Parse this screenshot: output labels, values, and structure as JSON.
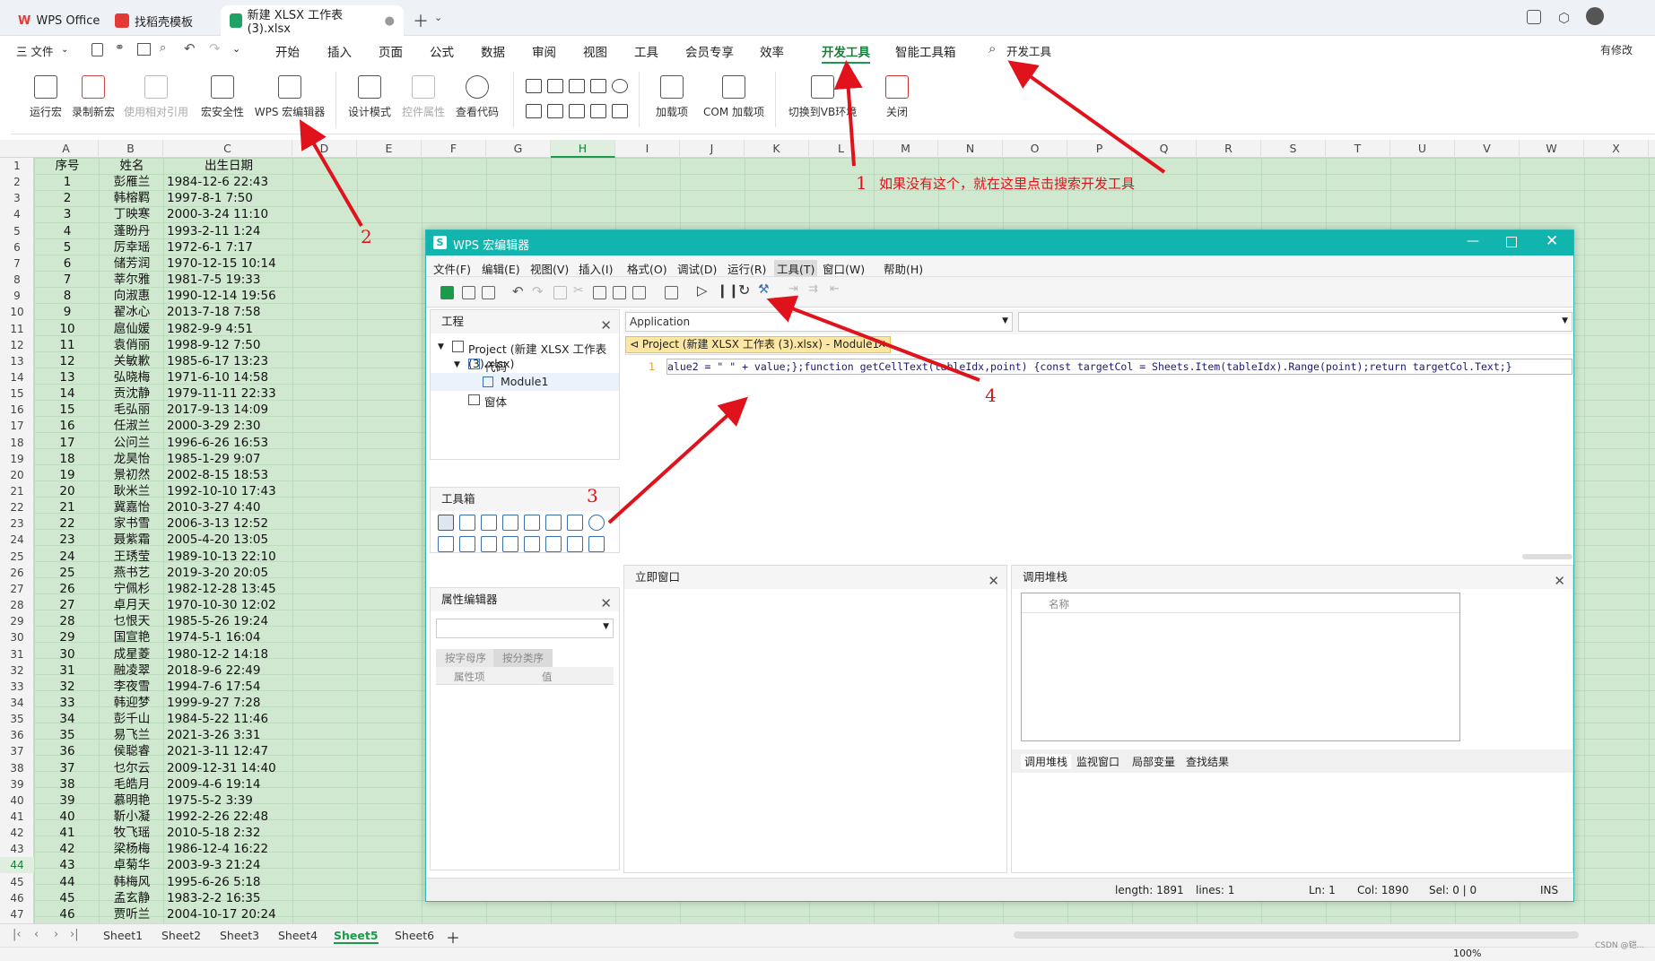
{
  "tabs": {
    "wps": "WPS Office",
    "template": "找稻壳模板",
    "doc": "新建 XLSX 工作表 (3).xlsx"
  },
  "menu": {
    "file": "三 文件",
    "items": [
      "开始",
      "插入",
      "页面",
      "公式",
      "数据",
      "审阅",
      "视图",
      "工具",
      "会员专享",
      "效率",
      "开发工具",
      "智能工具箱"
    ],
    "search": "开发工具",
    "edit_right": "有修改"
  },
  "ribbon": {
    "run_macro": "运行宏",
    "record_macro": "录制新宏",
    "relative_ref": "使用相对引用",
    "macro_security": "宏安全性",
    "wps_macro_editor": "WPS 宏编辑器",
    "design_mode": "设计模式",
    "control_props": "控件属性",
    "view_code": "查看代码",
    "addins": "加载项",
    "com_addins": "COM 加载项",
    "switch_vb": "切换到VB环境",
    "close": "关闭"
  },
  "columns": [
    "A",
    "B",
    "C",
    "D",
    "E",
    "F",
    "G",
    "H",
    "I",
    "J",
    "K",
    "L",
    "M",
    "N",
    "O",
    "P",
    "Q",
    "R",
    "S",
    "T",
    "U",
    "V",
    "W",
    "X"
  ],
  "header_row": [
    "序号",
    "姓名",
    "出生日期"
  ],
  "rows": [
    [
      "1",
      "彭雁兰",
      "1984-12-6 22:43"
    ],
    [
      "2",
      "韩榕羁",
      "1997-8-1 7:50"
    ],
    [
      "3",
      "丁映寒",
      "2000-3-24 11:10"
    ],
    [
      "4",
      "蓬盼丹",
      "1993-2-11 1:24"
    ],
    [
      "5",
      "厉幸瑶",
      "1972-6-1 7:17"
    ],
    [
      "6",
      "储芳润",
      "1970-12-15 10:14"
    ],
    [
      "7",
      "莘尔雅",
      "1981-7-5 19:33"
    ],
    [
      "8",
      "向淑惠",
      "1990-12-14 19:56"
    ],
    [
      "9",
      "翟冰心",
      "2013-7-18 7:58"
    ],
    [
      "10",
      "扈仙媛",
      "1982-9-9 4:51"
    ],
    [
      "11",
      "袁俏丽",
      "1998-9-12 7:50"
    ],
    [
      "12",
      "关敏歉",
      "1985-6-17 13:23"
    ],
    [
      "13",
      "弘晓梅",
      "1971-6-10 14:58"
    ],
    [
      "14",
      "贡沈静",
      "1979-11-11 22:33"
    ],
    [
      "15",
      "毛弘丽",
      "2017-9-13 14:09"
    ],
    [
      "16",
      "任淑兰",
      "2000-3-29 2:30"
    ],
    [
      "17",
      "公问兰",
      "1996-6-26 16:53"
    ],
    [
      "18",
      "龙昊怡",
      "1985-1-29 9:07"
    ],
    [
      "19",
      "景初然",
      "2002-8-15 18:53"
    ],
    [
      "20",
      "耿米兰",
      "1992-10-10 17:43"
    ],
    [
      "21",
      "冀嘉怡",
      "2010-3-27 4:40"
    ],
    [
      "22",
      "家书雪",
      "2006-3-13 12:52"
    ],
    [
      "23",
      "聂紫霜",
      "2005-4-20 13:05"
    ],
    [
      "24",
      "王琇莹",
      "1989-10-13 22:10"
    ],
    [
      "25",
      "燕书艺",
      "2019-3-20 20:05"
    ],
    [
      "26",
      "宁佩杉",
      "1982-12-28 13:45"
    ],
    [
      "27",
      "卓月天",
      "1970-10-30 12:02"
    ],
    [
      "28",
      "乜恨天",
      "1985-5-26 19:24"
    ],
    [
      "29",
      "国宣艳",
      "1974-5-1 16:04"
    ],
    [
      "30",
      "成星菱",
      "1980-12-2 14:18"
    ],
    [
      "31",
      "融凌翠",
      "2018-9-6 22:49"
    ],
    [
      "32",
      "李夜雪",
      "1994-7-6 17:54"
    ],
    [
      "33",
      "韩迎梦",
      "1999-9-27 7:28"
    ],
    [
      "34",
      "彭千山",
      "1984-5-22 11:46"
    ],
    [
      "35",
      "易飞兰",
      "2021-3-26 3:31"
    ],
    [
      "36",
      "侯聪睿",
      "2021-3-11 12:47"
    ],
    [
      "37",
      "乜尔云",
      "2009-12-31 14:40"
    ],
    [
      "38",
      "毛皓月",
      "2009-4-6 19:14"
    ],
    [
      "39",
      "慕明艳",
      "1975-5-2 3:39"
    ],
    [
      "40",
      "靳小凝",
      "1992-2-26 22:48"
    ],
    [
      "41",
      "牧飞瑶",
      "2010-5-18 2:32"
    ],
    [
      "42",
      "梁杨梅",
      "1986-12-4 16:22"
    ],
    [
      "43",
      "卓菊华",
      "2003-9-3 21:24"
    ],
    [
      "44",
      "韩梅风",
      "1995-6-26 5:18"
    ],
    [
      "45",
      "孟玄静",
      "1983-2-2 16:35"
    ],
    [
      "46",
      "贾听兰",
      "2004-10-17 20:24"
    ]
  ],
  "sheets": [
    "Sheet1",
    "Sheet2",
    "Sheet3",
    "Sheet4",
    "Sheet5",
    "Sheet6"
  ],
  "zoom": "100%",
  "watermark": "CSDN @铠...",
  "vbe": {
    "title": "WPS 宏编辑器",
    "menu": [
      "文件(F)",
      "编辑(E)",
      "视图(V)",
      "插入(I)",
      "格式(O)",
      "调试(D)",
      "运行(R)",
      "工具(T)",
      "窗口(W)",
      "帮助(H)"
    ],
    "project_pane": "工程",
    "project_root": "Project (新建 XLSX 工作表 (3).xlsx)",
    "code_folder": "代码",
    "module": "Module1",
    "form_folder": "窗体",
    "toolbox": "工具箱",
    "prop_editor": "属性编辑器",
    "prop_tab_alpha": "按字母序",
    "prop_tab_cat": "按分类序",
    "prop_col_name": "属性项",
    "prop_col_val": "值",
    "object_select": "Application",
    "doc_tab": "Project (新建 XLSX 工作表 (3).xlsx) - Module1",
    "line_no": "1",
    "code": "alue2 = \" \" + value;};function getCellText(tableIdx,point) {const targetCol = Sheets.Item(tableIdx).Range(point);return targetCol.Text;}",
    "immediate": "立即窗口",
    "callstack": "调用堆栈",
    "callstack_col": "名称",
    "bottom_tabs": [
      "调用堆栈",
      "监视窗口",
      "局部变量",
      "查找结果"
    ],
    "status": {
      "length": "length: 1891",
      "lines": "lines: 1",
      "ln": "Ln: 1",
      "col": "Col: 1890",
      "sel": "Sel: 0 | 0",
      "ins": "INS"
    }
  },
  "annotations": {
    "n1": "1",
    "n1_text": "如果没有这个，就在这里点击搜索开发工具",
    "n2": "2",
    "n3": "3",
    "n4": "4"
  }
}
